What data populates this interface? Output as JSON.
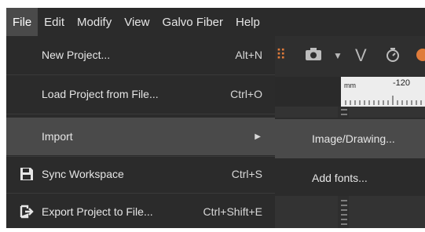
{
  "menubar": {
    "items": [
      {
        "label": "File"
      },
      {
        "label": "Edit"
      },
      {
        "label": "Modify"
      },
      {
        "label": "View"
      },
      {
        "label": "Galvo Fiber"
      },
      {
        "label": "Help"
      }
    ]
  },
  "file_menu": {
    "items": [
      {
        "label": "New Project...",
        "shortcut": "Alt+N"
      },
      {
        "label": "Load Project from File...",
        "shortcut": "Ctrl+O"
      },
      {
        "label": "Import",
        "submenu_indicator": "▶"
      },
      {
        "label": "Sync Workspace",
        "shortcut": "Ctrl+S",
        "icon": "floppy-disk-icon"
      },
      {
        "label": "Export Project to File...",
        "shortcut": "Ctrl+Shift+E",
        "icon": "export-icon"
      }
    ]
  },
  "import_submenu": {
    "items": [
      {
        "label": "Image/Drawing..."
      },
      {
        "label": "Add fonts..."
      }
    ]
  },
  "ruler": {
    "unit": "mm",
    "tick_label": "-120"
  },
  "colors": {
    "menu_bg": "#2b2b2b",
    "highlight": "#4a4a4a",
    "text": "#e6e6e6"
  }
}
